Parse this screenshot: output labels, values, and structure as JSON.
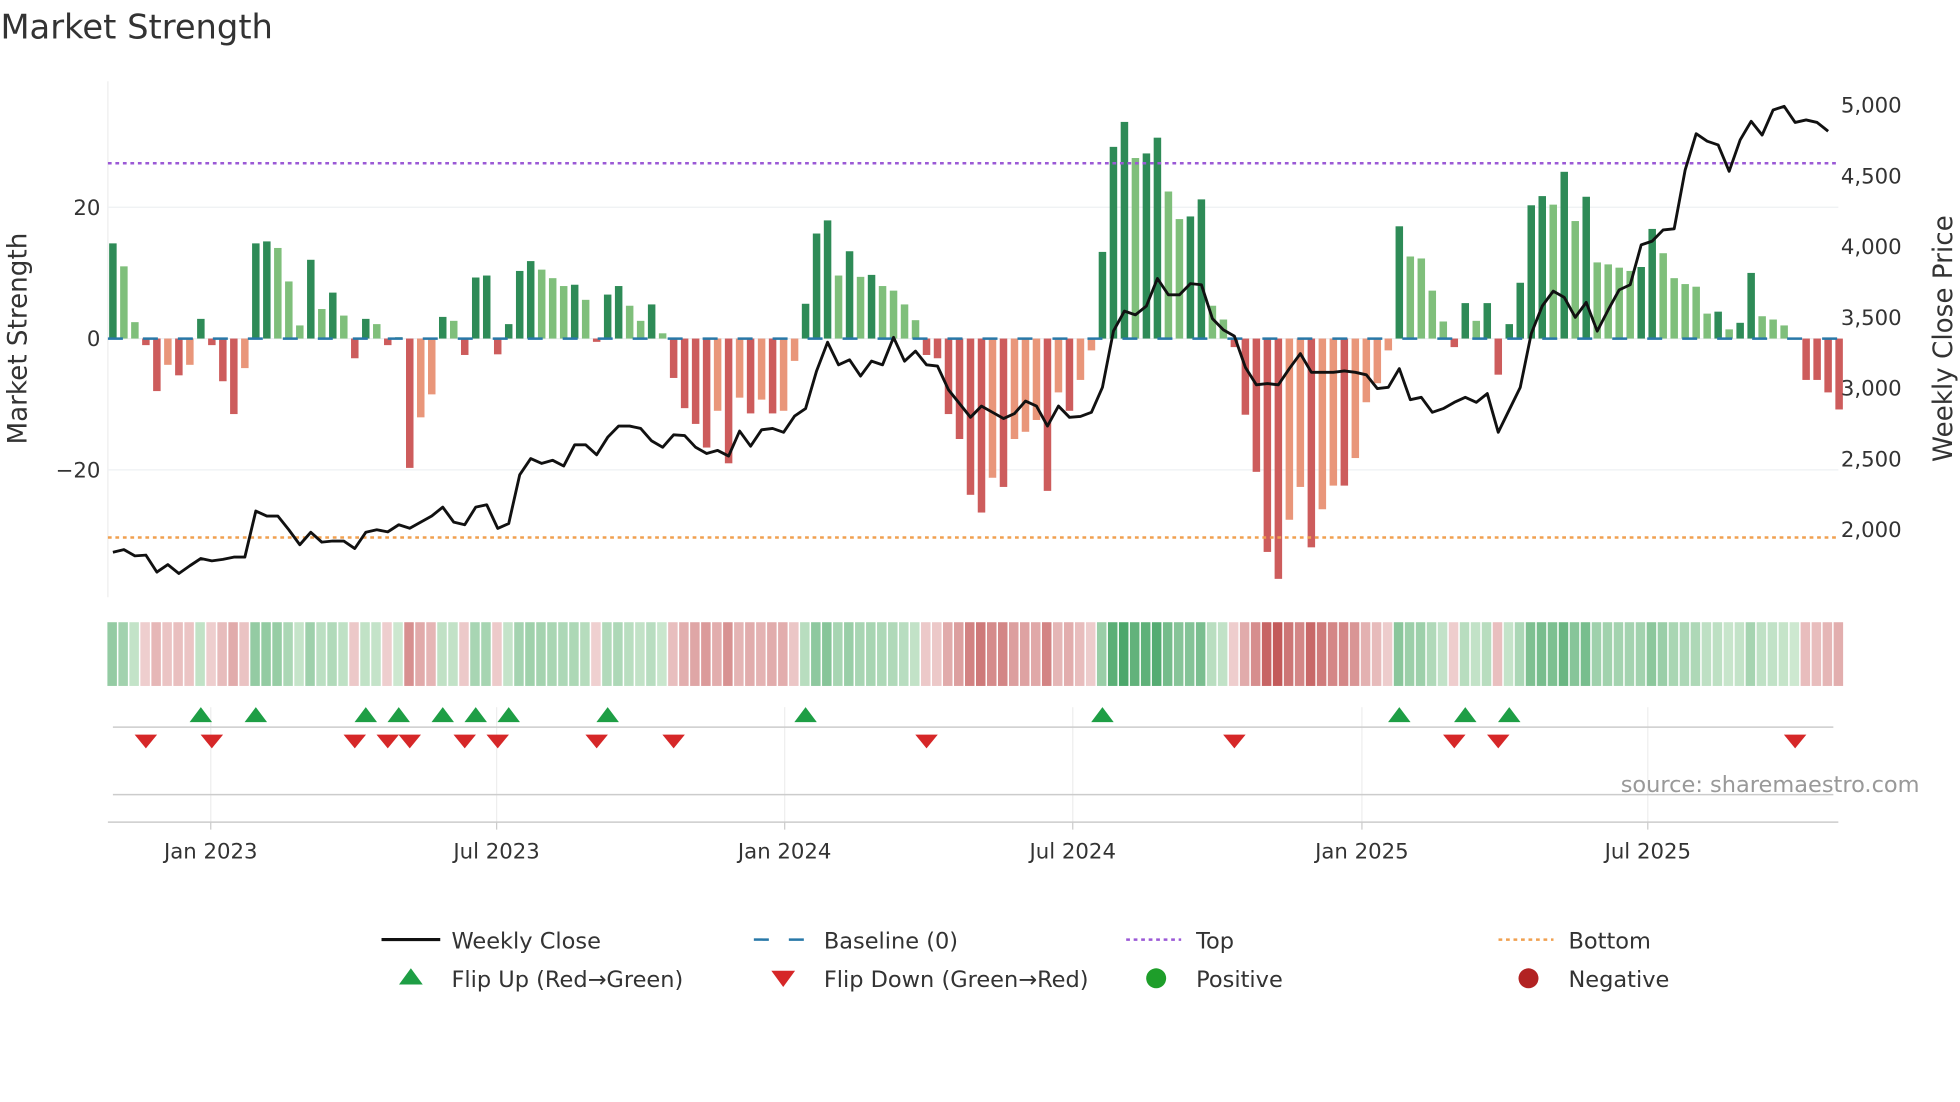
{
  "chart_data": {
    "type": "bar",
    "title": "Market Strength",
    "ylabel": "Market Strength",
    "y2label": "Weekly Close Price",
    "ylim": [
      -39.4,
      39.2
    ],
    "y2lim": [
      1523,
      5168
    ],
    "y_ticks": [
      20,
      0,
      -20
    ],
    "y_tick_labels": [
      "20",
      "0",
      "−20"
    ],
    "y2_ticks": [
      5000,
      4500,
      4000,
      3500,
      3000,
      2500,
      2000
    ],
    "y2_tick_labels": [
      "5,000",
      "4,500",
      "4,000",
      "3,500",
      "3,000",
      "2,500",
      "2,000"
    ],
    "x_unit": "weeks from first bar",
    "x_ticks": [
      8.9,
      34.9,
      61.1,
      87.3,
      113.6,
      139.6
    ],
    "x_tick_labels": [
      "Jan 2023",
      "Jul 2023",
      "Jan 2024",
      "Jul 2024",
      "Jan 2025",
      "Jul 2025"
    ],
    "top_level": 26.7,
    "bottom_level": -30.3,
    "baseline": 0,
    "strength": [
      14.5,
      11,
      2.5,
      -1,
      -8,
      -4,
      -5.6,
      -4,
      3,
      -1,
      -6.5,
      -11.5,
      -4.5,
      14.5,
      14.8,
      13.8,
      8.7,
      2,
      12,
      4.5,
      7,
      3.5,
      -3,
      3,
      2.2,
      -1,
      0.2,
      -19.7,
      -12,
      -8.5,
      3.3,
      2.7,
      -2.5,
      9.3,
      9.6,
      -2.4,
      2.2,
      10.3,
      11.8,
      10.5,
      9.2,
      8,
      8.2,
      5.9,
      -0.5,
      6.7,
      8,
      5,
      2.7,
      5.2,
      0.8,
      -6,
      -10.6,
      -13,
      -16.6,
      -11,
      -19,
      -9,
      -11.4,
      -9.3,
      -11.4,
      -11,
      -3.4,
      5.3,
      16,
      18,
      9.6,
      13.3,
      9.4,
      9.7,
      8,
      7.3,
      5.2,
      2.8,
      -2.5,
      -3,
      -11.5,
      -15.3,
      -23.8,
      -26.5,
      -21.2,
      -22.6,
      -15.3,
      -14.2,
      -12.4,
      -23.2,
      -8.2,
      -11,
      -6.3,
      -1.8,
      13.2,
      29.2,
      33,
      27.5,
      28.2,
      30.6,
      22.4,
      18.2,
      18.6,
      21.2,
      5,
      2.9,
      -1.3,
      -11.6,
      -20.3,
      -32.5,
      -36.6,
      -27.6,
      -22.6,
      -31.8,
      -26,
      -22.4,
      -22.4,
      -18.2,
      -9.7,
      -6.8,
      -1.8,
      17.1,
      12.5,
      12.2,
      7.3,
      2.6,
      -1.3,
      5.4,
      2.7,
      5.4,
      -5.5,
      2.2,
      8.5,
      20.3,
      21.7,
      20.4,
      25.4,
      17.9,
      21.6,
      11.6,
      11.3,
      10.8,
      10.3,
      10.9,
      16.7,
      13,
      9.2,
      8.3,
      7.9,
      3.8,
      4.1,
      1.4,
      2.4,
      10,
      3.4,
      2.9,
      2,
      0,
      -6.3,
      -6.3,
      -8.2,
      -10.8
    ],
    "weekly_close": [
      1841,
      1859,
      1815,
      1820,
      1700,
      1753,
      1691,
      1745,
      1797,
      1780,
      1790,
      1806,
      1806,
      2132,
      2097,
      2097,
      2000,
      1894,
      1982,
      1912,
      1920,
      1920,
      1867,
      1982,
      2000,
      1985,
      2035,
      2010,
      2053,
      2097,
      2159,
      2053,
      2035,
      2159,
      2176,
      2009,
      2044,
      2388,
      2503,
      2468,
      2490,
      2450,
      2600,
      2600,
      2529,
      2653,
      2732,
      2732,
      2715,
      2627,
      2582,
      2670,
      2665,
      2582,
      2538,
      2560,
      2520,
      2697,
      2590,
      2706,
      2715,
      2688,
      2803,
      2856,
      3121,
      3324,
      3165,
      3200,
      3085,
      3191,
      3165,
      3359,
      3190,
      3262,
      3165,
      3156,
      2988,
      2891,
      2794,
      2873,
      2829,
      2785,
      2820,
      2909,
      2873,
      2732,
      2873,
      2794,
      2800,
      2829,
      3006,
      3403,
      3544,
      3518,
      3580,
      3774,
      3659,
      3659,
      3738,
      3730,
      3491,
      3412,
      3368,
      3147,
      3023,
      3032,
      3023,
      3138,
      3244,
      3112,
      3112,
      3112,
      3121,
      3112,
      3094,
      2997,
      3006,
      3138,
      2918,
      2935,
      2829,
      2856,
      2900,
      2935,
      2900,
      2962,
      2688,
      2847,
      3006,
      3385,
      3580,
      3685,
      3641,
      3500,
      3606,
      3403,
      3553,
      3694,
      3730,
      4012,
      4038,
      4118,
      4126,
      4541,
      4797,
      4744,
      4718,
      4532,
      4753,
      4885,
      4788,
      4965,
      4991,
      4877,
      4894,
      4877,
      4815
    ],
    "flip_up_weeks": [
      8,
      13,
      23,
      26,
      30,
      33,
      36,
      45,
      63,
      90,
      117,
      123,
      127
    ],
    "flip_down_weeks": [
      3,
      9,
      22,
      25,
      27,
      32,
      35,
      44,
      51,
      74,
      102,
      122,
      126,
      153
    ],
    "legend": [
      {
        "label": "Weekly Close",
        "kind": "line",
        "color": "#111111"
      },
      {
        "label": "Baseline (0)",
        "kind": "dash",
        "color": "#2878a8"
      },
      {
        "label": "Top",
        "kind": "dot",
        "color": "#9b59d6"
      },
      {
        "label": "Bottom",
        "kind": "dot",
        "color": "#f0a050"
      },
      {
        "label": "Flip Up (Red→Green)",
        "kind": "up",
        "color": "#1e9e45"
      },
      {
        "label": "Flip Down (Green→Red)",
        "kind": "down",
        "color": "#d62728"
      },
      {
        "label": "Positive",
        "kind": "circle",
        "color": "#1e9e2a"
      },
      {
        "label": "Negative",
        "kind": "circle",
        "color": "#b22222"
      }
    ],
    "legend_placement": "bottom",
    "colors": {
      "pos_strong": "#2e8b57",
      "pos_weak": "#7fbf7b",
      "neg_strong": "#cd5c5c",
      "neg_weak": "#e9967a"
    }
  },
  "source": "source: sharemaestro.com"
}
